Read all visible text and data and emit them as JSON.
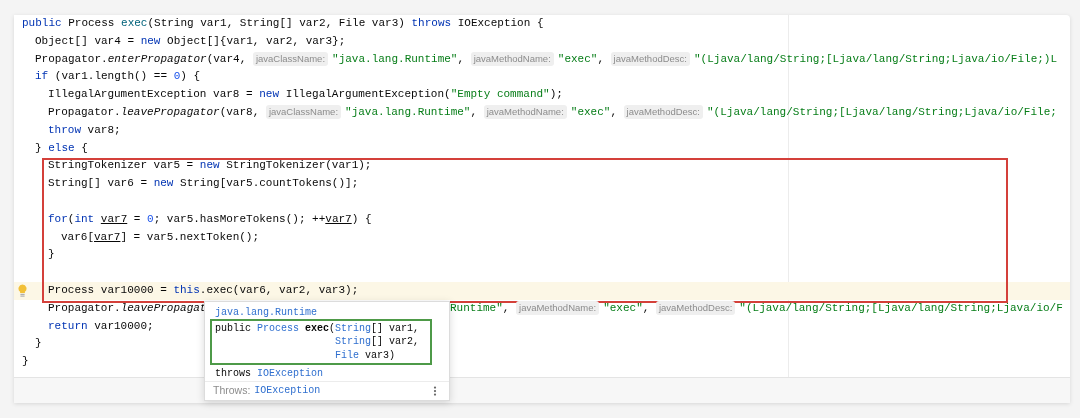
{
  "editor": {
    "blocks": [
      {
        "kind": "lines",
        "lines": [
          {
            "kind": "top",
            "tokens": [
              {
                "kind": "keyword",
                "text": "public"
              },
              {
                "kind": "plain",
                "text": " Process "
              },
              {
                "kind": "decl",
                "text": "exec"
              },
              {
                "kind": "plain",
                "text": "(String var1, String[] var2, File var3) "
              },
              {
                "kind": "keyword",
                "text": "throws"
              },
              {
                "kind": "plain",
                "text": " IOException {"
              }
            ]
          },
          {
            "kind": "body",
            "tokens": [
              {
                "kind": "plain",
                "text": "Object[] var4 = "
              },
              {
                "kind": "keyword",
                "text": "new"
              },
              {
                "kind": "plain",
                "text": " Object[]{var1, var2, var3};"
              }
            ]
          },
          {
            "kind": "body",
            "tokens": [
              {
                "kind": "plain",
                "text": "Propagator."
              },
              {
                "kind": "static",
                "text": "enterPropagator"
              },
              {
                "kind": "plain",
                "text": "(var4, "
              },
              {
                "kind": "hint",
                "text": "javaClassName:"
              },
              {
                "kind": "string",
                "text": "\"java.lang.Runtime\""
              },
              {
                "kind": "plain",
                "text": ", "
              },
              {
                "kind": "hint",
                "text": "javaMethodName:"
              },
              {
                "kind": "string",
                "text": "\"exec\""
              },
              {
                "kind": "plain",
                "text": ", "
              },
              {
                "kind": "hint",
                "text": "javaMethodDesc:"
              },
              {
                "kind": "string",
                "text": "\"(Ljava/lang/String;[Ljava/lang/String;Ljava/io/File;)L"
              }
            ]
          },
          {
            "kind": "body",
            "tokens": [
              {
                "kind": "keyword",
                "text": "if"
              },
              {
                "kind": "plain",
                "text": " (var1.length() == "
              },
              {
                "kind": "number",
                "text": "0"
              },
              {
                "kind": "plain",
                "text": ") {"
              }
            ]
          },
          {
            "kind": "nested",
            "tokens": [
              {
                "kind": "plain",
                "text": "IllegalArgumentException var8 = "
              },
              {
                "kind": "keyword",
                "text": "new"
              },
              {
                "kind": "plain",
                "text": " IllegalArgumentException("
              },
              {
                "kind": "string",
                "text": "\"Empty command\""
              },
              {
                "kind": "plain",
                "text": ");"
              }
            ]
          },
          {
            "kind": "nested",
            "tokens": [
              {
                "kind": "plain",
                "text": "Propagator."
              },
              {
                "kind": "static",
                "text": "leavePropagator"
              },
              {
                "kind": "plain",
                "text": "(var8, "
              },
              {
                "kind": "hint",
                "text": "javaClassName:"
              },
              {
                "kind": "string",
                "text": "\"java.lang.Runtime\""
              },
              {
                "kind": "plain",
                "text": ", "
              },
              {
                "kind": "hint",
                "text": "javaMethodName:"
              },
              {
                "kind": "string",
                "text": "\"exec\""
              },
              {
                "kind": "plain",
                "text": ", "
              },
              {
                "kind": "hint",
                "text": "javaMethodDesc:"
              },
              {
                "kind": "string",
                "text": "\"(Ljava/lang/String;[Ljava/lang/String;Ljava/io/File;"
              }
            ]
          },
          {
            "kind": "nested",
            "tokens": [
              {
                "kind": "keyword",
                "text": "throw"
              },
              {
                "kind": "plain",
                "text": " var8;"
              }
            ]
          },
          {
            "kind": "body",
            "tokens": [
              {
                "kind": "plain",
                "text": "} "
              },
              {
                "kind": "keyword",
                "text": "else"
              },
              {
                "kind": "plain",
                "text": " {"
              }
            ]
          }
        ]
      },
      {
        "kind": "framed",
        "color": "#d4403a",
        "lines": [
          {
            "kind": "nested",
            "tokens": [
              {
                "kind": "plain",
                "text": "StringTokenizer var5 = "
              },
              {
                "kind": "keyword",
                "text": "new"
              },
              {
                "kind": "plain",
                "text": " StringTokenizer(var1);"
              }
            ]
          },
          {
            "kind": "nested",
            "tokens": [
              {
                "kind": "plain",
                "text": "String[] var6 = "
              },
              {
                "kind": "keyword",
                "text": "new"
              },
              {
                "kind": "plain",
                "text": " String[var5.countTokens()];"
              }
            ]
          },
          {
            "kind": "blank"
          },
          {
            "kind": "nested",
            "tokens": [
              {
                "kind": "keyword",
                "text": "for"
              },
              {
                "kind": "plain",
                "text": "("
              },
              {
                "kind": "keyword",
                "text": "int"
              },
              {
                "kind": "reassigned",
                "space_before": true,
                "text": "var7"
              },
              {
                "kind": "plain",
                "text": " = "
              },
              {
                "kind": "number",
                "text": "0"
              },
              {
                "kind": "plain",
                "text": "; var5.hasMoreTokens(); ++"
              },
              {
                "kind": "reassigned",
                "space_before": false,
                "text": "var7"
              },
              {
                "kind": "plain",
                "text": ") {"
              }
            ]
          },
          {
            "kind": "deep",
            "tokens": [
              {
                "kind": "plain",
                "text": "var6["
              },
              {
                "kind": "reassigned",
                "space_before": false,
                "text": "var7"
              },
              {
                "kind": "plain",
                "text": "] = var5.nextToken();"
              }
            ]
          },
          {
            "kind": "nested",
            "tokens": [
              {
                "kind": "plain",
                "text": "}"
              }
            ]
          },
          {
            "kind": "blank"
          },
          {
            "kind": "nested",
            "current": true,
            "bulb": true,
            "tokens": [
              {
                "kind": "plain",
                "text": "Process var10000 = "
              },
              {
                "kind": "keyword",
                "text": "this"
              },
              {
                "kind": "plain",
                "text": ".exec(var6, var2, var3);"
              }
            ]
          }
        ]
      },
      {
        "kind": "lines",
        "lines": [
          {
            "kind": "nested",
            "tokens": [
              {
                "kind": "plain",
                "text": "Propagator."
              },
              {
                "kind": "static",
                "text": "leavePropagat"
              }
            ],
            "tokens_after_popup": [
              {
                "kind": "string",
                "text": "Runtime\""
              },
              {
                "kind": "plain",
                "text": ", "
              },
              {
                "kind": "hint",
                "text": "javaMethodName:"
              },
              {
                "kind": "string",
                "text": "\"exec\""
              },
              {
                "kind": "plain",
                "text": ", "
              },
              {
                "kind": "hint",
                "text": "javaMethodDesc:"
              },
              {
                "kind": "string",
                "text": "\"(Ljava/lang/String;[Ljava/lang/String;Ljava/io/F"
              }
            ]
          },
          {
            "kind": "nested",
            "tokens": [
              {
                "kind": "keyword",
                "text": "return"
              },
              {
                "kind": "plain",
                "text": " var10000;"
              }
            ]
          },
          {
            "kind": "body",
            "tokens": [
              {
                "kind": "plain",
                "text": "}"
              }
            ]
          },
          {
            "kind": "top",
            "tokens": [
              {
                "kind": "plain",
                "text": "}"
              }
            ]
          }
        ]
      }
    ]
  },
  "doc_popup": {
    "class_link": "java.lang.Runtime",
    "signature": [
      {
        "kind": "first",
        "tokens": [
          {
            "kind": "plain",
            "text": "public "
          },
          {
            "kind": "type",
            "text": "Process"
          },
          {
            "kind": "bold",
            "space_before": true,
            "text": "exec"
          },
          {
            "kind": "plain",
            "text": "("
          },
          {
            "kind": "type",
            "text": "String"
          },
          {
            "kind": "plain",
            "text": "[] var1,"
          }
        ]
      },
      {
        "kind": "continued",
        "tokens": [
          {
            "kind": "type",
            "text": "String"
          },
          {
            "kind": "plain",
            "text": "[] var2,"
          }
        ]
      },
      {
        "kind": "continued",
        "tokens": [
          {
            "kind": "type",
            "text": "File"
          },
          {
            "kind": "plain",
            "text": " var3)"
          }
        ]
      },
      {
        "kind": "throws",
        "tokens": [
          {
            "kind": "plain",
            "text": "throws "
          },
          {
            "kind": "type",
            "text": "IOException"
          }
        ]
      }
    ],
    "frame": {
      "color": "#4e9a48"
    },
    "footer_label": "Throws:",
    "footer_link": "IOException"
  }
}
